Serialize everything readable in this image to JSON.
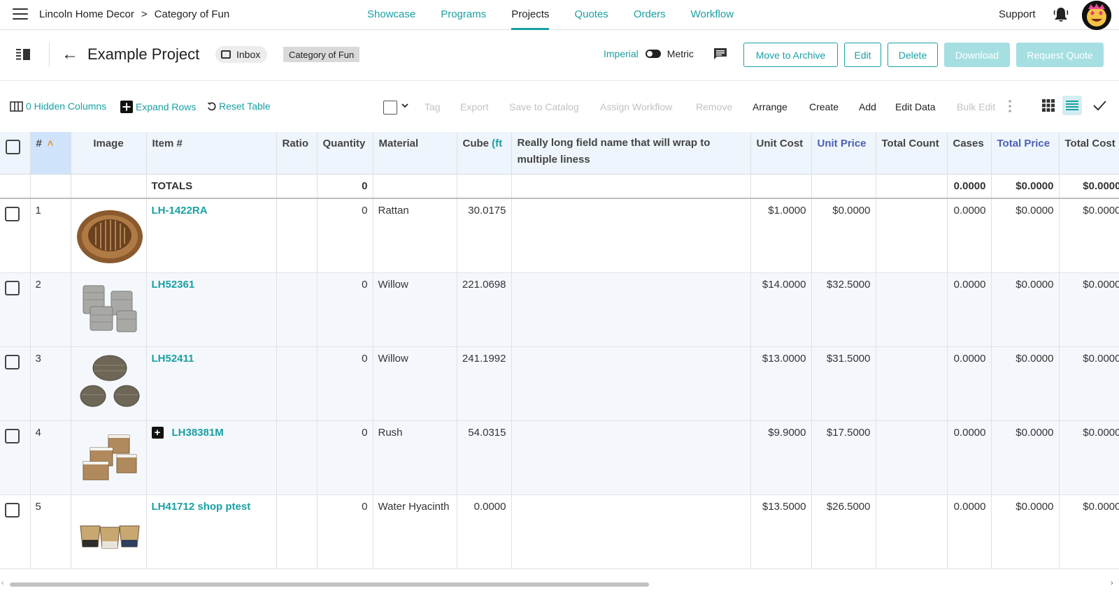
{
  "topnav": {
    "breadcrumb": [
      "Lincoln Home Decor",
      "Category of Fun"
    ],
    "breadcrumb_sep": ">",
    "nav": [
      "Showcase",
      "Programs",
      "Projects",
      "Quotes",
      "Orders",
      "Workflow"
    ],
    "active_nav": "Projects",
    "support_label": "Support",
    "accent_color": "#1a9fa3"
  },
  "project": {
    "title": "Example Project",
    "inbox_label": "Inbox",
    "category_chip": "Category of Fun",
    "unit_imperial": "Imperial",
    "unit_metric": "Metric",
    "buttons": {
      "archive": "Move to Archive",
      "edit": "Edit",
      "delete": "Delete",
      "download": "Download",
      "request_quote": "Request Quote"
    }
  },
  "toolbar": {
    "hidden_columns": "0 Hidden Columns",
    "expand_rows": "Expand Rows",
    "reset_table": "Reset Table",
    "actions": {
      "tag": "Tag",
      "export": "Export",
      "save_to_catalog": "Save to Catalog",
      "assign_workflow": "Assign Workflow",
      "remove": "Remove",
      "arrange": "Arrange",
      "create": "Create",
      "add": "Add",
      "edit_data": "Edit Data",
      "bulk_edit": "Bulk Edit"
    }
  },
  "table": {
    "headers": {
      "num": "#",
      "image": "Image",
      "item": "Item #",
      "ratio": "Ratio",
      "quantity": "Quantity",
      "material": "Material",
      "cube": "Cube",
      "cube_unit": "(ft",
      "long_field": "Really long field name that will wrap to multiple liness",
      "unit_cost": "Unit Cost",
      "unit_price": "Unit Price",
      "total_count": "Total Count",
      "cases": "Cases",
      "total_price": "Total Price",
      "total_cost": "Total Cost"
    },
    "totals": {
      "label": "TOTALS",
      "quantity": "0",
      "cases": "0.0000",
      "total_price": "$0.0000",
      "total_cost": "$0.0000"
    },
    "rows": [
      {
        "num": "1",
        "item": "LH-1422RA",
        "quantity": "0",
        "material": "Rattan",
        "cube": "30.0175",
        "unit_cost": "$1.0000",
        "unit_price": "$0.0000",
        "cases": "0.0000",
        "total_price": "$0.0000",
        "total_cost": "$0.0000"
      },
      {
        "num": "2",
        "item": "LH52361",
        "quantity": "0",
        "material": "Willow",
        "cube": "221.0698",
        "unit_cost": "$14.0000",
        "unit_price": "$32.5000",
        "cases": "0.0000",
        "total_price": "$0.0000",
        "total_cost": "$0.0000"
      },
      {
        "num": "3",
        "item": "LH52411",
        "quantity": "0",
        "material": "Willow",
        "cube": "241.1992",
        "unit_cost": "$13.0000",
        "unit_price": "$31.5000",
        "cases": "0.0000",
        "total_price": "$0.0000",
        "total_cost": "$0.0000"
      },
      {
        "num": "4",
        "item": "LH38381M",
        "quantity": "0",
        "material": "Rush",
        "cube": "54.0315",
        "unit_cost": "$9.9000",
        "unit_price": "$17.5000",
        "cases": "0.0000",
        "total_price": "$0.0000",
        "total_cost": "$0.0000"
      },
      {
        "num": "5",
        "item": "LH41712 shop ptest",
        "quantity": "0",
        "material": "Water Hyacinth",
        "cube": "0.0000",
        "unit_cost": "$13.5000",
        "unit_price": "$26.5000",
        "cases": "0.0000",
        "total_price": "$0.0000",
        "total_cost": "$0.0000"
      }
    ]
  }
}
